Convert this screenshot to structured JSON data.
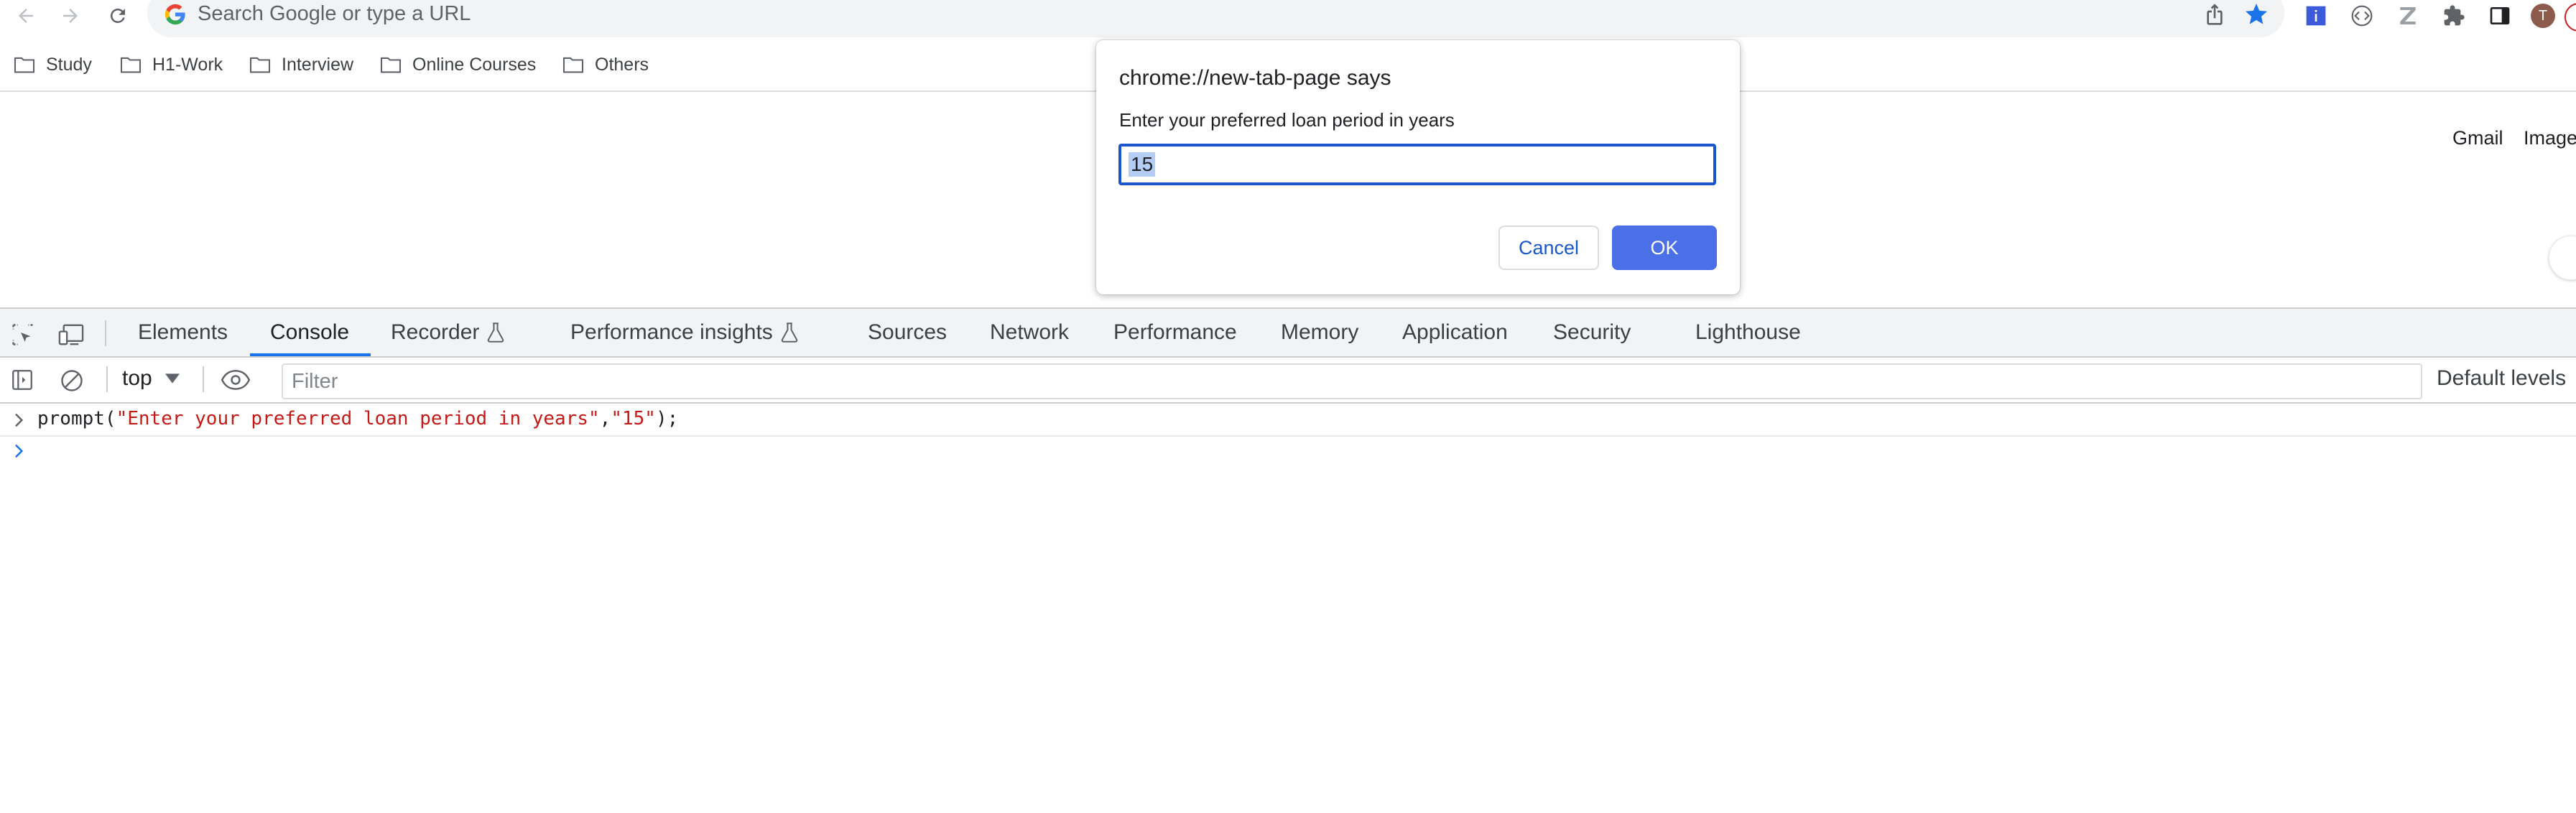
{
  "browser": {
    "omnibox_placeholder": "Search Google or type a URL",
    "bookmarks": [
      "Study",
      "H1-Work",
      "Interview",
      "Online Courses",
      "Others"
    ],
    "avatar_letter": "T",
    "accent_color": "#1a73e8"
  },
  "page": {
    "gmail_link": "Gmail",
    "images_link": "Images"
  },
  "dialog": {
    "title": "chrome://new-tab-page says",
    "message": "Enter your preferred loan period in years",
    "input_value": "15",
    "cancel_label": "Cancel",
    "ok_label": "OK"
  },
  "devtools": {
    "tabs": [
      "Elements",
      "Console",
      "Recorder",
      "Performance insights",
      "Sources",
      "Network",
      "Performance",
      "Memory",
      "Application",
      "Security",
      "Lighthouse"
    ],
    "active_tab": "Console",
    "context": "top",
    "filter_placeholder": "Filter",
    "levels_label": "Default levels",
    "console": {
      "cmd_fn": "prompt(",
      "cmd_arg1": "\"Enter your preferred loan period in years\"",
      "cmd_comma": ",",
      "cmd_arg2": "\"15\"",
      "cmd_end": ");"
    }
  }
}
